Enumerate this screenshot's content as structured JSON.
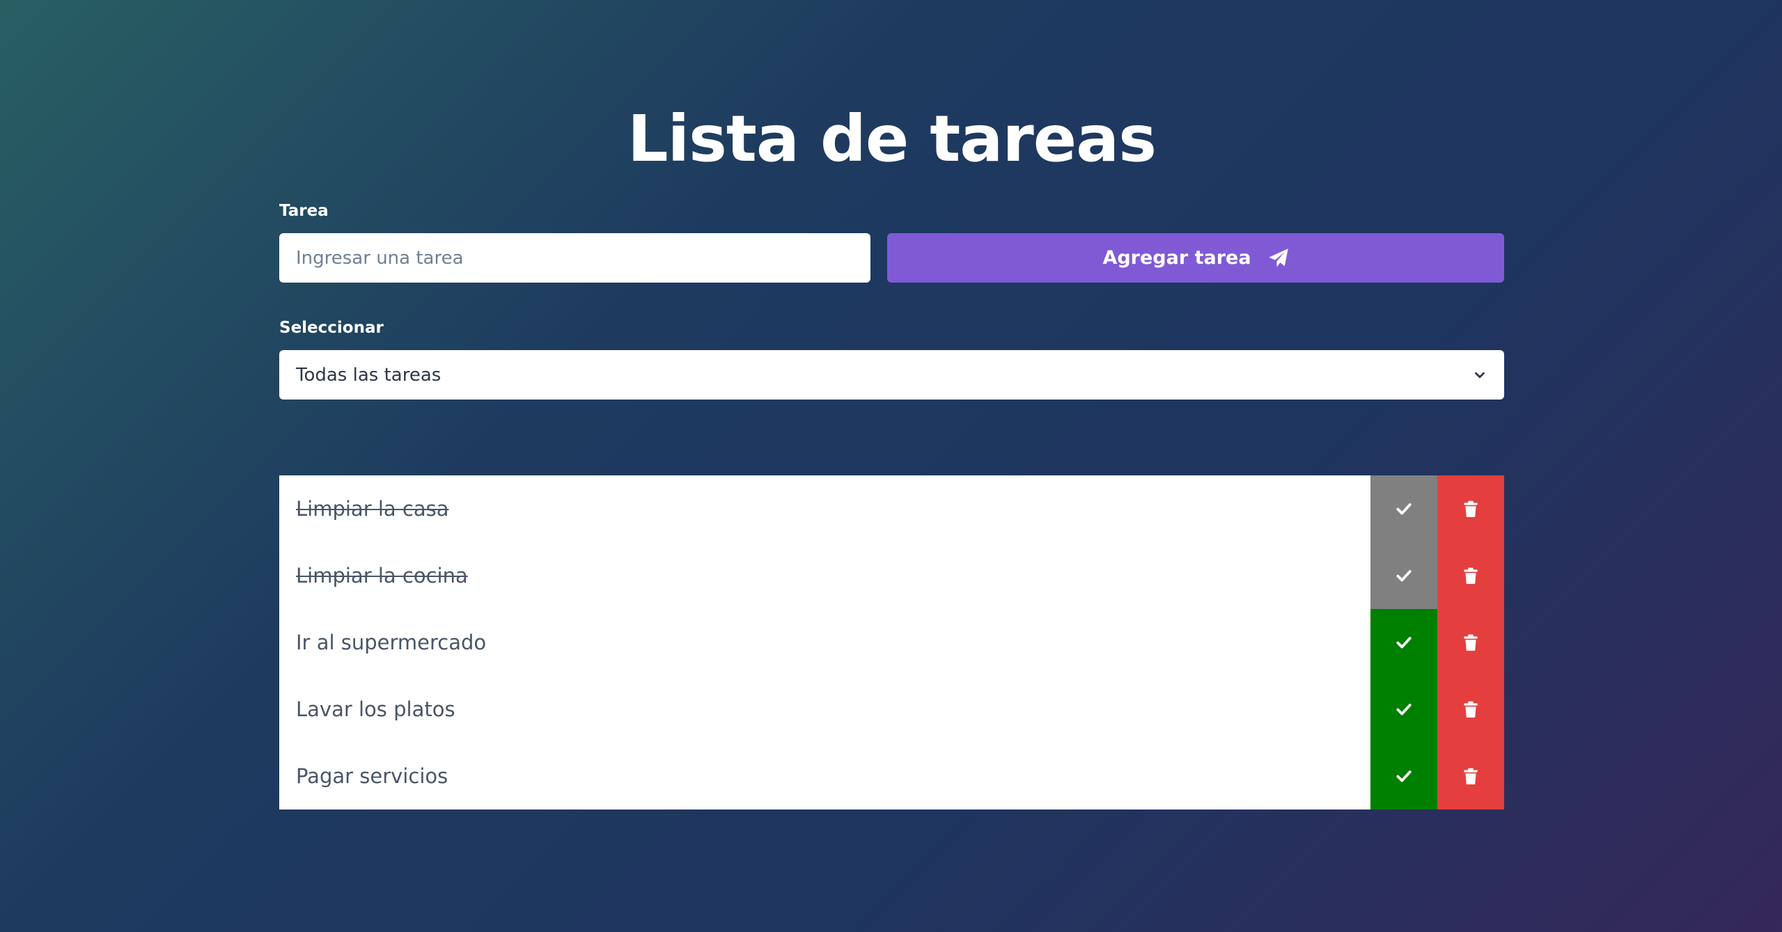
{
  "header": {
    "title": "Lista de tareas"
  },
  "form": {
    "task_label": "Tarea",
    "task_placeholder": "Ingresar una tarea",
    "add_button_label": "Agregar tarea",
    "select_label": "Seleccionar",
    "select_value": "Todas las tareas"
  },
  "colors": {
    "accent": "#805ad5",
    "completed_toggle": "#808080",
    "pending_toggle": "#008000",
    "delete": "#e53e3e"
  },
  "icons": {
    "add": "paper-plane-icon",
    "select": "chevron-down-icon",
    "complete": "check-icon",
    "delete": "trash-icon"
  },
  "tasks": [
    {
      "text": "Limpiar la casa",
      "completed": true
    },
    {
      "text": "Limpiar la cocina",
      "completed": true
    },
    {
      "text": "Ir al supermercado",
      "completed": false
    },
    {
      "text": "Lavar los platos",
      "completed": false
    },
    {
      "text": "Pagar servicios",
      "completed": false
    }
  ]
}
